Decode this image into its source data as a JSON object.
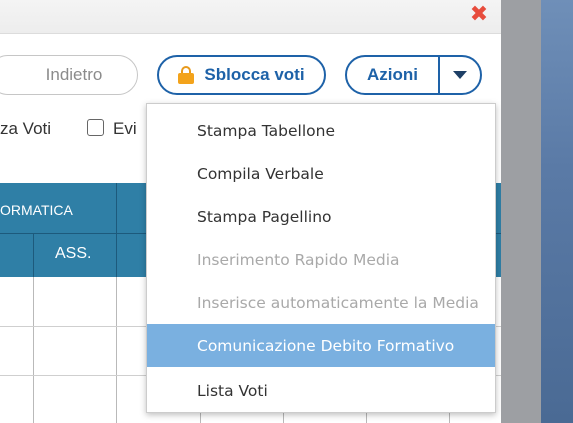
{
  "window": {
    "close_glyph": "✖",
    "close_color": "#e74c3c"
  },
  "toolbar": {
    "back_label": "Indietro",
    "unlock_label": "Sblocca voti",
    "actions_label": "Azioni"
  },
  "filters": {
    "label_left": "za Voti",
    "label_right": "Evi"
  },
  "grid": {
    "header_subject": "ORMATICA",
    "header_sub": "ASS."
  },
  "menu": {
    "items": [
      {
        "label": "Stampa Tabellone",
        "state": "enabled"
      },
      {
        "label": "Compila Verbale",
        "state": "enabled"
      },
      {
        "label": "Stampa Pagellino",
        "state": "enabled"
      },
      {
        "label": "Inserimento Rapido Media",
        "state": "disabled"
      },
      {
        "label": "Inserisce automaticamente la Media",
        "state": "disabled"
      },
      {
        "label": "Comunicazione Debito Formativo",
        "state": "highlighted"
      },
      {
        "label": "Lista Voti",
        "state": "enabled"
      }
    ]
  },
  "colors": {
    "accent": "#1e62a8",
    "header_bg": "#2f7fa6",
    "highlight": "#7ab0e0",
    "lock": "#f3a31b"
  }
}
